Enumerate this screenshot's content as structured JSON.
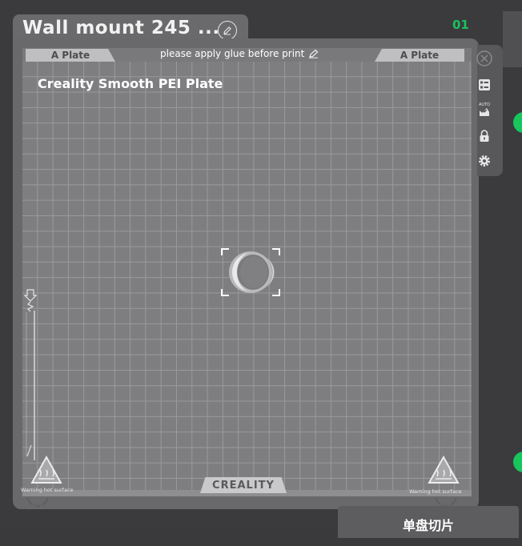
{
  "header": {
    "title": "Wall mount 245 ...",
    "plate_number": "01"
  },
  "plate": {
    "tag_left": "A Plate",
    "tag_right": "A Plate",
    "notice": "please apply glue before print",
    "bed_type": "Creality Smooth PEI Plate",
    "logo": "CREALITY",
    "warning_left": "Warning hot surface",
    "warning_right": "Warning hot surface"
  },
  "toolbar": {
    "auto_label": "AUTO"
  },
  "actions": {
    "slice_label": "单盘切片"
  },
  "colors": {
    "accent": "#17c75d",
    "bed": "#7e7e81",
    "grid": "#9a9a9d"
  }
}
